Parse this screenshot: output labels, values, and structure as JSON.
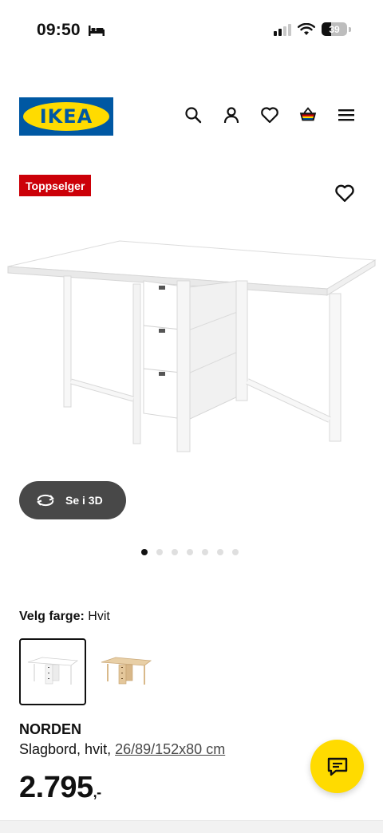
{
  "status_bar": {
    "time": "09:50",
    "battery_level": "39",
    "battery_fraction": 0.39,
    "signal_bars_active": 2,
    "signal_bars_total": 4
  },
  "header": {
    "logo_text": "IKEA",
    "icons": [
      "search-icon",
      "account-icon",
      "heart-icon",
      "basket-icon",
      "menu-icon"
    ]
  },
  "product": {
    "badge": "Toppselger",
    "view_3d_label": "Se i 3D",
    "image_count": 7,
    "active_image_index": 0,
    "color_label": "Velg farge:",
    "color_value": "Hvit",
    "name": "NORDEN",
    "description": "Slagbord, hvit,",
    "measurement": "26/89/152x80 cm",
    "price_integer": "2.795",
    "price_suffix": ",-"
  },
  "colors": {
    "brand_blue": "#0058a3",
    "brand_yellow": "#ffdb00",
    "badge_red": "#cc0008",
    "button_dark": "#484848"
  }
}
